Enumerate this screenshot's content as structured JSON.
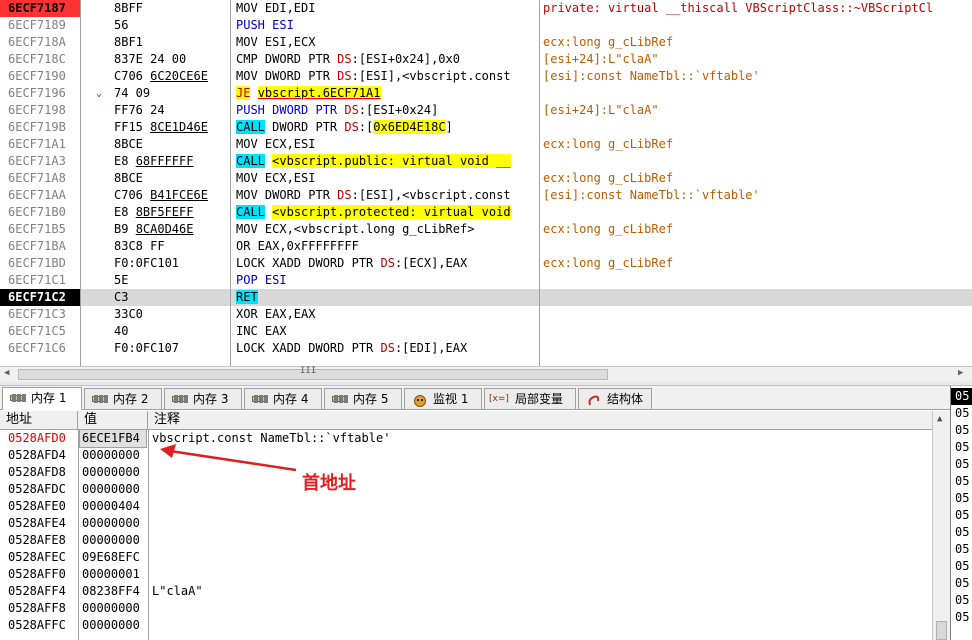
{
  "disasm": {
    "rows": [
      {
        "addr": "6ECF7187",
        "hex": "8BFF",
        "asm": [
          [
            "MOV EDI,EDI",
            ""
          ]
        ],
        "cmt": "private: virtual __thiscall VBScriptClass::~VBScriptCl"
      },
      {
        "addr": "6ECF7189",
        "hex": "56",
        "asm": [
          [
            "PUSH ESI",
            "m-blue"
          ]
        ],
        "cmt": ""
      },
      {
        "addr": "6ECF718A",
        "hex": "8BF1",
        "asm": [
          [
            "MOV ESI,ECX",
            ""
          ]
        ],
        "cmt": "ecx:long g_cLibRef"
      },
      {
        "addr": "6ECF718C",
        "hex": "837E 24 00",
        "asm": [
          [
            "CMP DWORD PTR ",
            ""
          ],
          [
            "DS",
            "seg"
          ],
          [
            ":[ESI+0x24],0x0",
            ""
          ]
        ],
        "cmt": "[esi+24]:L\"claA\""
      },
      {
        "addr": "6ECF7190",
        "hex": "C706 6C20CE6E",
        "asm": [
          [
            "MOV DWORD PTR ",
            ""
          ],
          [
            "DS",
            "seg"
          ],
          [
            ":[ESI],<vbscript.const",
            ""
          ]
        ],
        "cmt": "[esi]:const NameTbl::`vftable'"
      },
      {
        "addr": "6ECF7196",
        "hex": "74 09",
        "asm": [
          [
            "JE",
            "m-jmp"
          ],
          [
            " ",
            ""
          ],
          [
            "vbscript.6ECF71A1",
            "target-red"
          ]
        ],
        "cmt": ""
      },
      {
        "addr": "6ECF7198",
        "hex": "FF76 24",
        "asm": [
          [
            "PUSH DWORD PTR ",
            "m-blue"
          ],
          [
            "DS",
            "seg"
          ],
          [
            ":[ESI+0x24]",
            ""
          ]
        ],
        "cmt": "[esi+24]:L\"claA\""
      },
      {
        "addr": "6ECF719B",
        "hex": "FF15 8CE1D46E",
        "asm": [
          [
            "CALL",
            "m-call"
          ],
          [
            " DWORD PTR ",
            ""
          ],
          [
            "DS",
            "seg"
          ],
          [
            ":[",
            ""
          ],
          [
            "0x6ED4E18C",
            "target-yel"
          ],
          [
            "]",
            ""
          ]
        ],
        "cmt": ""
      },
      {
        "addr": "6ECF71A1",
        "hex": "8BCE",
        "asm": [
          [
            "MOV ECX,ESI",
            ""
          ]
        ],
        "cmt": "ecx:long g_cLibRef"
      },
      {
        "addr": "6ECF71A3",
        "hex": "E8 68FFFFFF",
        "asm": [
          [
            "CALL",
            "m-call"
          ],
          [
            " ",
            ""
          ],
          [
            "<vbscript.public: virtual void __",
            "target-yel"
          ]
        ],
        "cmt": ""
      },
      {
        "addr": "6ECF71A8",
        "hex": "8BCE",
        "asm": [
          [
            "MOV ECX,ESI",
            ""
          ]
        ],
        "cmt": "ecx:long g_cLibRef"
      },
      {
        "addr": "6ECF71AA",
        "hex": "C706 B41FCE6E",
        "asm": [
          [
            "MOV DWORD PTR ",
            ""
          ],
          [
            "DS",
            "seg"
          ],
          [
            ":[ESI],<vbscript.const",
            ""
          ]
        ],
        "cmt": "[esi]:const NameTbl::`vftable'"
      },
      {
        "addr": "6ECF71B0",
        "hex": "E8 8BF5FEFF",
        "asm": [
          [
            "CALL",
            "m-call"
          ],
          [
            " ",
            ""
          ],
          [
            "<vbscript.protected: virtual void",
            "target-yel"
          ]
        ],
        "cmt": ""
      },
      {
        "addr": "6ECF71B5",
        "hex": "B9 8CA0D46E",
        "asm": [
          [
            "MOV ECX,<vbscript.long g_cLibRef>",
            ""
          ]
        ],
        "cmt": "ecx:long g_cLibRef"
      },
      {
        "addr": "6ECF71BA",
        "hex": "83C8 FF",
        "asm": [
          [
            "OR EAX,0xFFFFFFFF",
            ""
          ]
        ],
        "cmt": ""
      },
      {
        "addr": "6ECF71BD",
        "hex": "F0:0FC101",
        "asm": [
          [
            "LOCK XADD DWORD PTR ",
            ""
          ],
          [
            "DS",
            "seg"
          ],
          [
            ":[ECX],EAX",
            ""
          ]
        ],
        "cmt": "ecx:long g_cLibRef"
      },
      {
        "addr": "6ECF71C1",
        "hex": "5E",
        "asm": [
          [
            "POP ESI",
            "m-blue"
          ]
        ],
        "cmt": ""
      },
      {
        "addr": "6ECF71C2",
        "hex": "C3",
        "asm": [
          [
            "RET",
            "m-call"
          ]
        ],
        "cmt": ""
      },
      {
        "addr": "6ECF71C3",
        "hex": "33C0",
        "asm": [
          [
            "XOR EAX,EAX",
            ""
          ]
        ],
        "cmt": ""
      },
      {
        "addr": "6ECF71C5",
        "hex": "40",
        "asm": [
          [
            "INC EAX",
            ""
          ]
        ],
        "cmt": ""
      },
      {
        "addr": "6ECF71C6",
        "hex": "F0:0FC107",
        "asm": [
          [
            "LOCK XADD DWORD PTR ",
            ""
          ],
          [
            "DS",
            "seg"
          ],
          [
            ":[EDI],EAX",
            ""
          ]
        ],
        "cmt": ""
      }
    ],
    "jump_marker": "⌄",
    "scroll_grip": "III"
  },
  "tabs": [
    {
      "label": "内存 1",
      "active": true
    },
    {
      "label": "内存 2",
      "active": false
    },
    {
      "label": "内存 3",
      "active": false
    },
    {
      "label": "内存 4",
      "active": false
    },
    {
      "label": "内存 5",
      "active": false
    },
    {
      "label": "监视 1",
      "active": false
    },
    {
      "label": "局部变量",
      "active": false
    },
    {
      "label": "结构体",
      "active": false
    }
  ],
  "locals_tag": "[x=]",
  "dump": {
    "headers": {
      "address": "地址",
      "value": "值",
      "comment": "注释"
    },
    "rows": [
      {
        "addr": "0528AFD0",
        "val": "6ECE1FB4",
        "cmt": "vbscript.const NameTbl::`vftable'"
      },
      {
        "addr": "0528AFD4",
        "val": "00000000",
        "cmt": ""
      },
      {
        "addr": "0528AFD8",
        "val": "00000000",
        "cmt": ""
      },
      {
        "addr": "0528AFDC",
        "val": "00000000",
        "cmt": ""
      },
      {
        "addr": "0528AFE0",
        "val": "00000404",
        "cmt": ""
      },
      {
        "addr": "0528AFE4",
        "val": "00000000",
        "cmt": ""
      },
      {
        "addr": "0528AFE8",
        "val": "00000000",
        "cmt": ""
      },
      {
        "addr": "0528AFEC",
        "val": "09E68EFC",
        "cmt": ""
      },
      {
        "addr": "0528AFF0",
        "val": "00000001",
        "cmt": ""
      },
      {
        "addr": "0528AFF4",
        "val": "08238FF4",
        "cmt": "L\"claA\""
      },
      {
        "addr": "0528AFF8",
        "val": "00000000",
        "cmt": ""
      },
      {
        "addr": "0528AFFC",
        "val": "00000000",
        "cmt": ""
      }
    ],
    "annotation": "首地址"
  },
  "right_pane": {
    "items": [
      "05",
      "05",
      "05",
      "05",
      "05",
      "05",
      "05",
      "05",
      "05",
      "05",
      "05",
      "05",
      "05",
      "05"
    ]
  },
  "colors": {
    "eip_bg": "#ff3232",
    "selected_addr_bg": "#000000",
    "annotation": "#e02020",
    "comment": "#b85c00"
  }
}
